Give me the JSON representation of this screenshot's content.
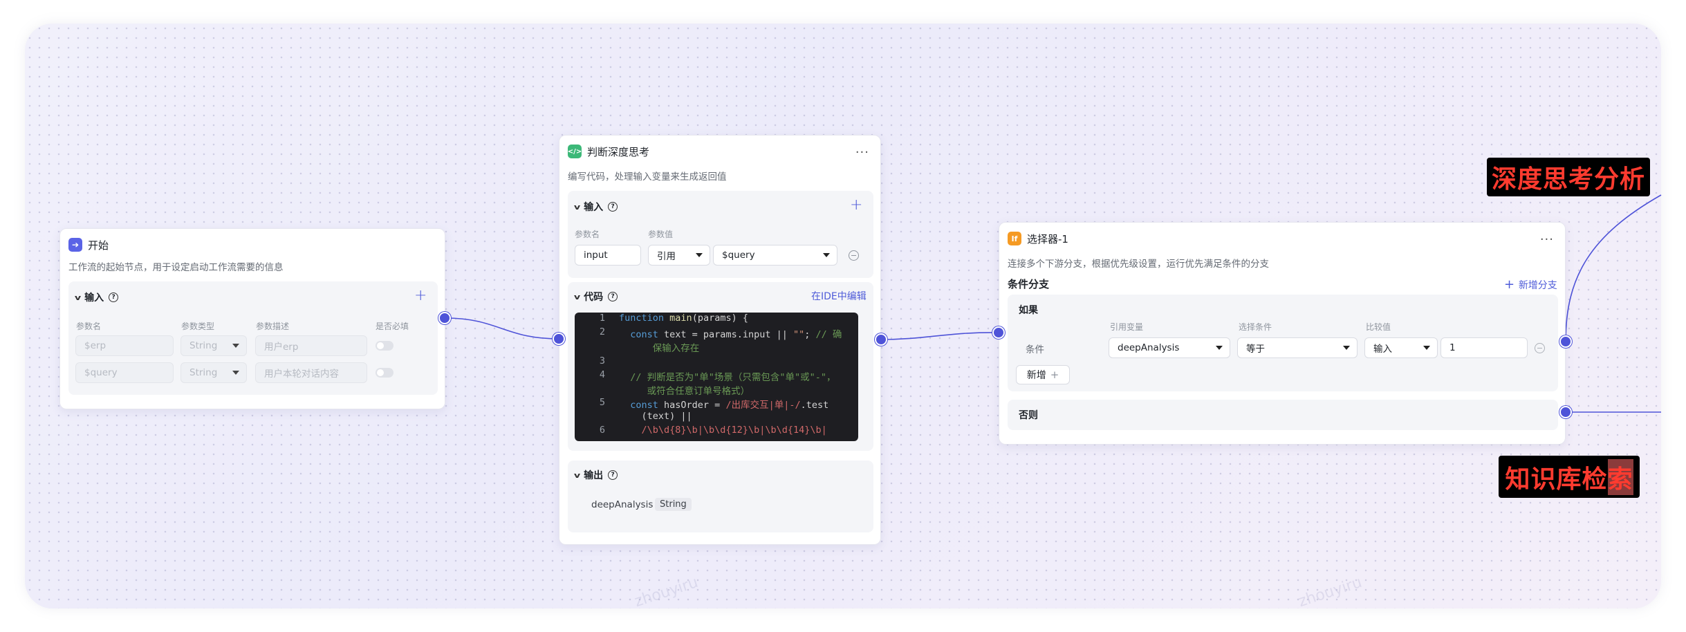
{
  "watermark": "zhouyiru",
  "start_node": {
    "title": "开始",
    "description": "工作流的起始节点，用于设定启动工作流需要的信息",
    "input_section": "输入",
    "columns": [
      "参数名",
      "参数类型",
      "参数描述",
      "是否必填"
    ],
    "rows": [
      {
        "name": "$erp",
        "type": "String",
        "desc": "用户erp"
      },
      {
        "name": "$query",
        "type": "String",
        "desc": "用户本轮对话内容"
      }
    ]
  },
  "code_node": {
    "title": "判断深度思考",
    "description": "编写代码，处理输入变量来生成返回值",
    "input_section": "输入",
    "columns": [
      "参数名",
      "参数值"
    ],
    "input_name": "input",
    "ref_type": "引用",
    "ref_value": "$query",
    "code_section": "代码",
    "ide_link": "在IDE中编辑",
    "code_lines": {
      "l1": "1",
      "l2": "2",
      "l3": "3",
      "l4": "4",
      "l5": "5",
      "l6": "6"
    },
    "output_section": "输出",
    "output_name": "deepAnalysis",
    "output_type": "String"
  },
  "selector_node": {
    "icon": "If",
    "title": "选择器-1",
    "description": "连接多个下游分支，根据优先级设置，运行优先满足条件的分支",
    "branch_section": "条件分支",
    "add_branch": "新增分支",
    "if_label": "如果",
    "columns": [
      "引用变量",
      "选择条件",
      "比较值"
    ],
    "condition_label": "条件",
    "ref_var": "deepAnalysis",
    "operator": "等于",
    "compare_type": "输入",
    "compare_value": "1",
    "add_button": "新增",
    "else_label": "否则"
  },
  "annotations": {
    "top": "深度思考分析",
    "bottom_prefix": "知识库检",
    "bottom_highlight": "索"
  },
  "colors": {
    "accent": "#4e53d8",
    "start_icon": "#5a63e6",
    "code_icon": "#3cb878",
    "selector_icon": "#f59a23",
    "annotation_text": "#ff3b2f"
  }
}
